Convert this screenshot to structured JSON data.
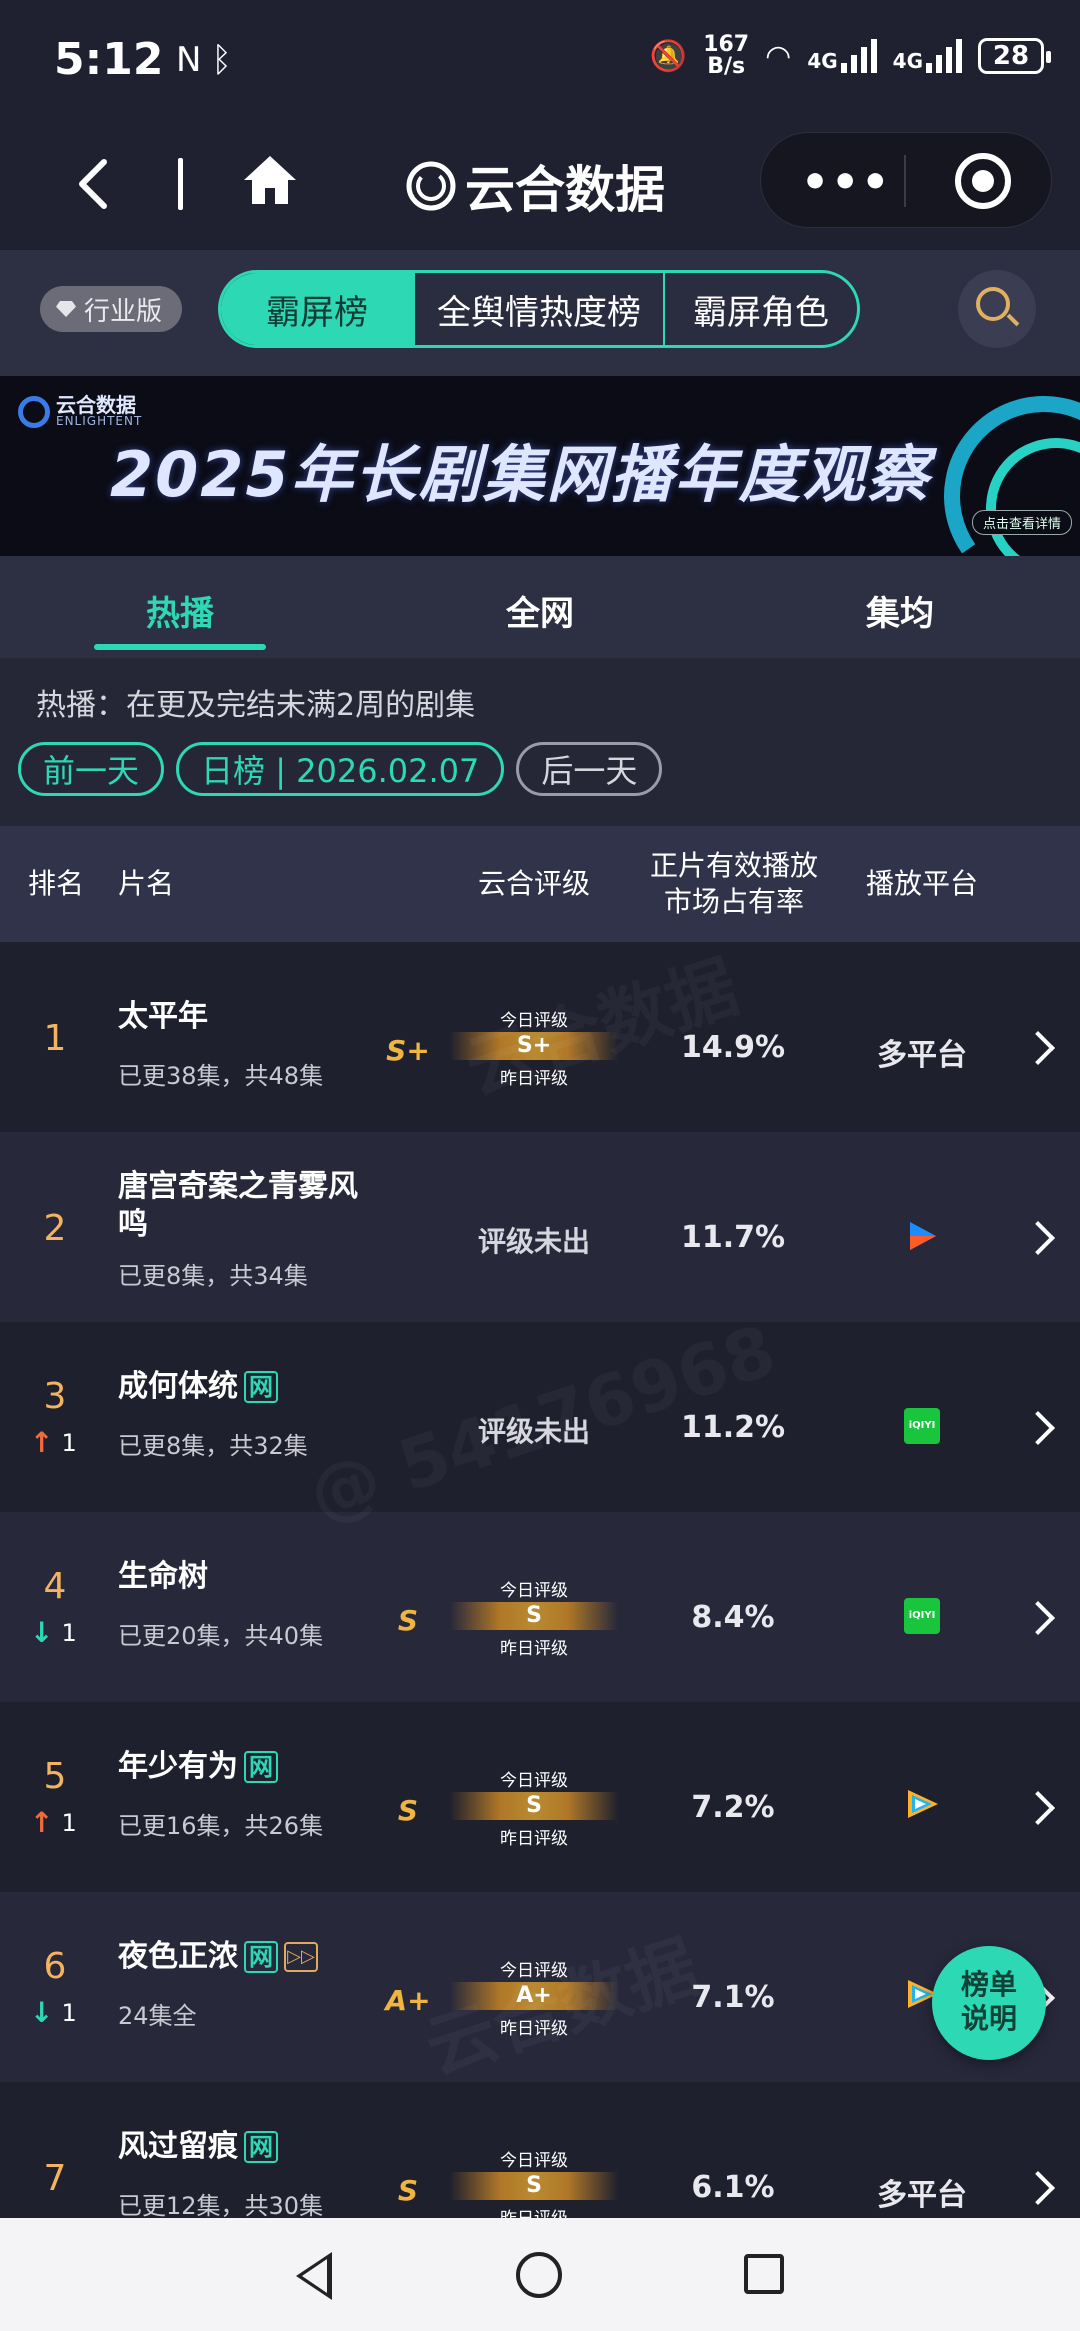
{
  "status_bar": {
    "time": "5:12",
    "speed_top": "167",
    "speed_bottom": "B/s",
    "signal1": "4G",
    "signal2": "4G",
    "battery": "28"
  },
  "nav": {
    "title": "云合数据"
  },
  "top_tabs": {
    "edition": "行业版",
    "tabs": [
      "霸屏榜",
      "全舆情热度榜",
      "霸屏角色"
    ],
    "active": "霸屏榜"
  },
  "banner": {
    "logo_text": "云合数据",
    "logo_sub": "ENLIGHTENT",
    "title": "2025年长剧集网播年度观察",
    "link": "点击查看详情"
  },
  "sub_tabs": {
    "items": [
      "热播",
      "全网",
      "集均"
    ],
    "active": "热播"
  },
  "description": "热播：在更及完结未满2周的剧集",
  "date_nav": {
    "prev": "前一天",
    "current": "日榜 | 2026.02.07",
    "next": "后一天"
  },
  "table": {
    "headers": {
      "rank": "排名",
      "title": "片名",
      "grade": "云合评级",
      "share_line1": "正片有效播放",
      "share_line2": "市场占有率",
      "platform": "播放平台"
    },
    "today_label": "今日评级",
    "yesterday_label": "昨日评级",
    "rows": [
      {
        "rank": "1",
        "title": "太平年",
        "episodes": "已更38集，共48集",
        "grade_left": "S+",
        "grade": "S+",
        "share": "14.9%",
        "platform": "多平台"
      },
      {
        "rank": "2",
        "title": "唐宫奇案之青雾风鸣",
        "episodes": "已更8集，共34集",
        "grade_none": "评级未出",
        "share": "11.7%",
        "platform_icon": "youku-icon"
      },
      {
        "rank": "3",
        "change": "1",
        "change_dir": "up",
        "title": "成何体统",
        "net_tag": "网",
        "episodes": "已更8集，共32集",
        "grade_none": "评级未出",
        "share": "11.2%",
        "platform_icon": "iqiyi-icon",
        "iqiyi_label": "iQIYI"
      },
      {
        "rank": "4",
        "change": "1",
        "change_dir": "down",
        "title": "生命树",
        "episodes": "已更20集，共40集",
        "grade_left": "S",
        "grade": "S",
        "share": "8.4%",
        "platform_icon": "iqiyi-icon",
        "iqiyi_label": "iQIYI"
      },
      {
        "rank": "5",
        "change": "1",
        "change_dir": "up",
        "title": "年少有为",
        "net_tag": "网",
        "episodes": "已更16集，共26集",
        "grade_left": "S",
        "grade": "S",
        "share": "7.2%",
        "platform_icon": "tencent-video-icon"
      },
      {
        "rank": "6",
        "change": "1",
        "change_dir": "down",
        "title": "夜色正浓",
        "net_tag": "网",
        "episodes": "24集全",
        "grade_left": "A+",
        "grade": "A+",
        "share": "7.1%",
        "platform_icon": "tencent-video-icon"
      },
      {
        "rank": "7",
        "title": "风过留痕",
        "net_tag": "网",
        "episodes": "已更12集，共30集",
        "grade_left": "S",
        "grade": "S",
        "share": "6.1%",
        "platform": "多平台"
      }
    ]
  },
  "float_button": {
    "line1": "榜单",
    "line2": "说明"
  },
  "watermark": {
    "brand": "云合数据",
    "brand_en": "ENLIGHTENT",
    "user": "@ 54176968"
  },
  "colors": {
    "accent": "#2dd8b5",
    "rank": "#f3b35f",
    "grade": "#f0b440",
    "up": "#ef6b3c",
    "down": "#2dd8b5"
  }
}
